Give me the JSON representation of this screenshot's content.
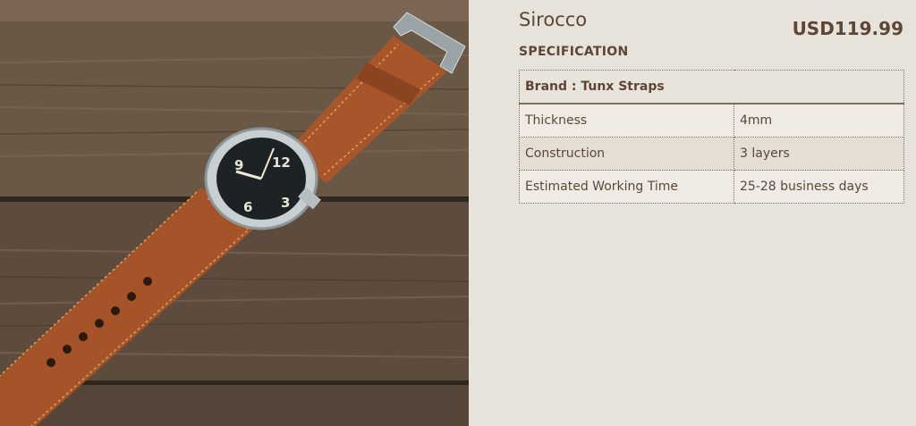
{
  "product": {
    "name": "Sirocco",
    "price": "USD119.99"
  },
  "specification": {
    "heading": "SPECIFICATION",
    "brand_row": "Brand : Tunx Straps",
    "rows": [
      {
        "label": "Thickness",
        "value": "4mm"
      },
      {
        "label": "Construction",
        "value": "3 layers"
      },
      {
        "label": "Estimated Working Time",
        "value": "25-28 business days"
      }
    ]
  },
  "colors": {
    "background": "#e8e3da",
    "text": "#5c4736",
    "strap": "#a8562a",
    "wood": "#5f4e3f"
  },
  "watch_dial": {
    "numerals": [
      "12",
      "3",
      "6",
      "9"
    ]
  }
}
